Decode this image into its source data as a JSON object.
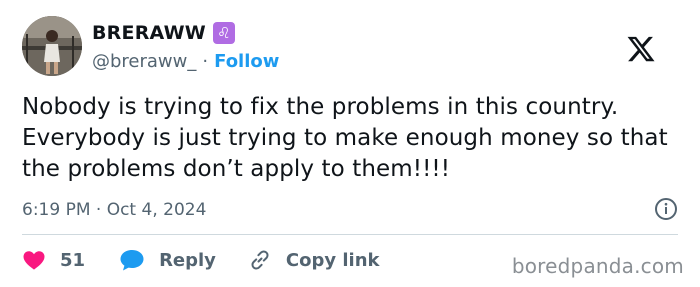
{
  "author": {
    "display_name": "BRERAWW",
    "badge_symbol": "♌",
    "handle": "@breraww_",
    "separator": "·",
    "follow_label": "Follow"
  },
  "tweet": {
    "text": "Nobody is trying to fix the problems in this country. Everybody is just trying to make enough money so that the problems don’t apply to them!!!!",
    "timestamp": "6:19 PM · Oct 4, 2024"
  },
  "actions": {
    "like_count": "51",
    "reply_label": "Reply",
    "copy_label": "Copy link"
  },
  "watermark": "boredpanda.com",
  "icons": {
    "platform": "x-logo-icon",
    "info": "info-icon",
    "like": "heart-icon",
    "reply": "speech-bubble-icon",
    "copy": "link-icon"
  },
  "colors": {
    "accent": "#1d9bf0",
    "like": "#f91880",
    "badge": "#b06ce3",
    "text": "#0f1419",
    "muted": "#536471"
  }
}
